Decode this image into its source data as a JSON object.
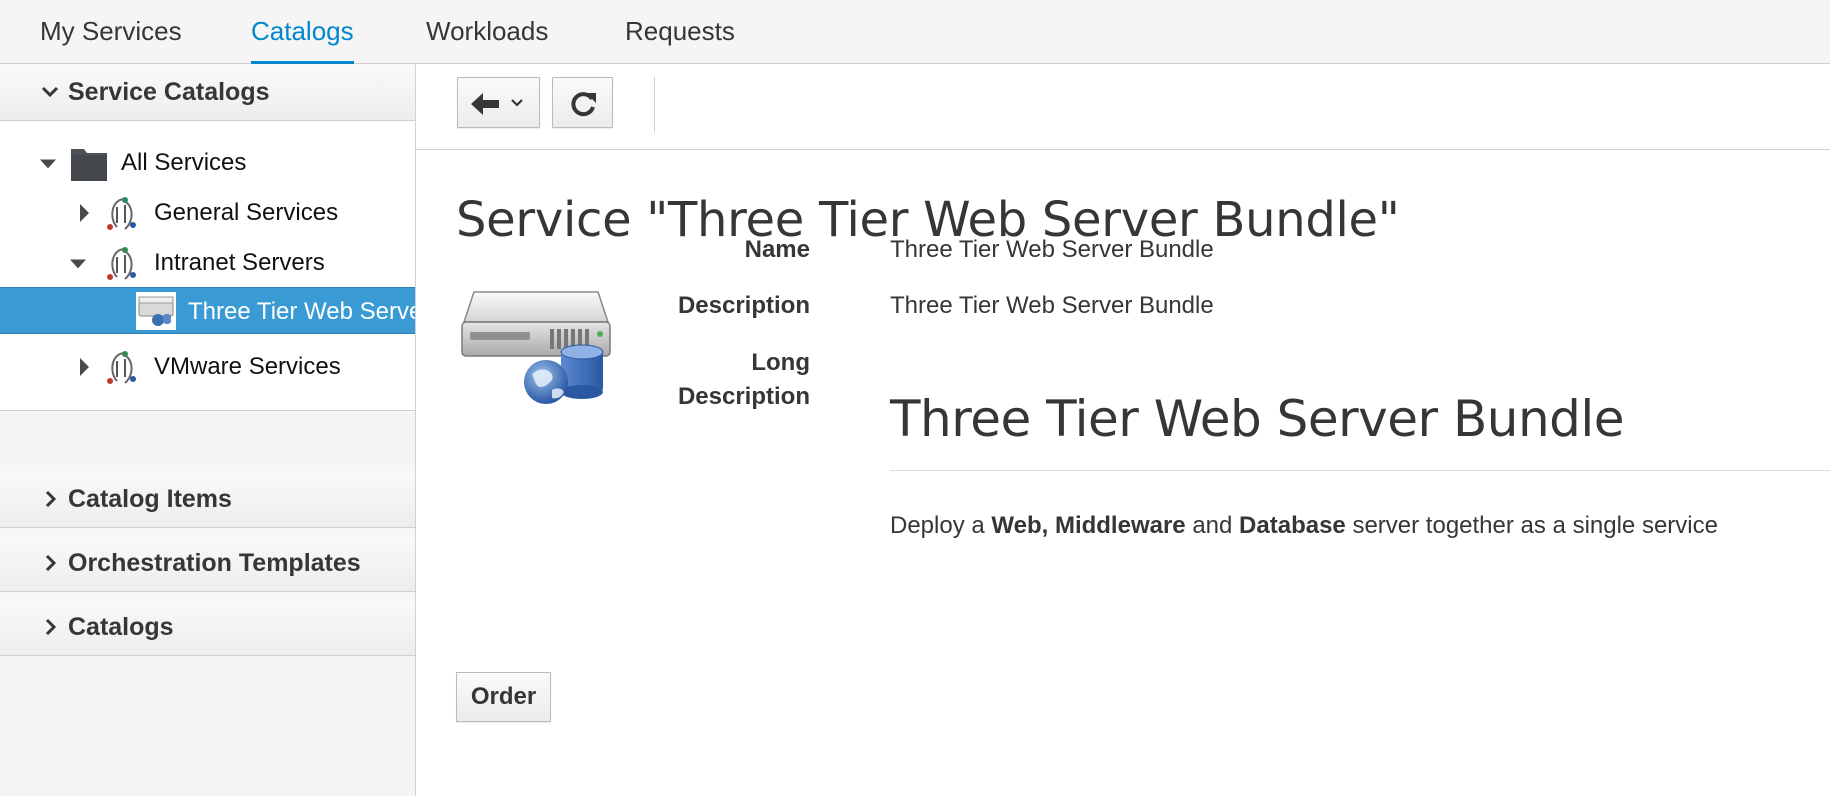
{
  "topnav": {
    "tabs": [
      {
        "label": "My Services"
      },
      {
        "label": "Catalogs"
      },
      {
        "label": "Workloads"
      },
      {
        "label": "Requests"
      }
    ],
    "active_tab": "Catalogs",
    "accent_color": "#0088ce"
  },
  "sidebar": {
    "sections": [
      {
        "label": "Service Catalogs",
        "expanded": true
      },
      {
        "label": "Catalog Items",
        "expanded": false
      },
      {
        "label": "Orchestration Templates",
        "expanded": false
      },
      {
        "label": "Catalogs",
        "expanded": false
      }
    ],
    "tree": [
      {
        "label": "All Services",
        "icon": "folder-icon",
        "state": "expanded"
      },
      {
        "label": "General Services",
        "icon": "catalog-icon",
        "state": "collapsed"
      },
      {
        "label": "Intranet Servers",
        "icon": "catalog-icon",
        "state": "expanded"
      },
      {
        "label": "Three Tier Web Server Bundle",
        "icon": "server-bundle-icon",
        "state": "selected"
      },
      {
        "label": "VMware Services",
        "icon": "catalog-icon",
        "state": "collapsed"
      }
    ],
    "selected_color": "#3a9bd4"
  },
  "toolbar": {
    "back_icon": "arrow-left-icon",
    "dropdown_icon": "chevron-down-icon",
    "refresh_icon": "refresh-icon"
  },
  "main": {
    "title": "Service \"Three Tier Web Server Bundle\"",
    "icon": "server-bundle-icon",
    "fields": {
      "name_label": "Name",
      "name_value": "Three Tier Web Server Bundle",
      "description_label": "Description",
      "description_value": "Three Tier Web Server Bundle",
      "long_label_line1": "Long",
      "long_label_line2": "Description"
    },
    "long_description": {
      "heading": "Three Tier Web Server Bundle",
      "text_1": "Deploy a ",
      "bold_1": "Web, Middleware",
      "text_2": " and ",
      "bold_2": "Database",
      "text_3": " server together as a single service"
    },
    "order_label": "Order"
  }
}
